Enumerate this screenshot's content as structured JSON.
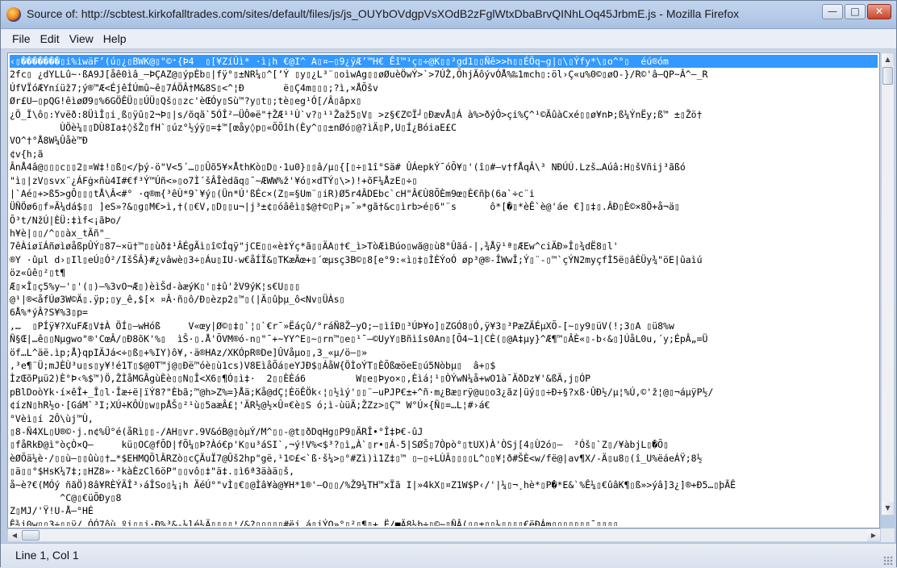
{
  "window": {
    "title": "Source of: http://scbtest.kirkofalltrades.com/sites/default/files/js/js_OUYbOVdgpVsXOdB2zFglWtxDbaBrvQINhLOq45JrbmE.js - Mozilla Firefox",
    "controls": {
      "minimize": "—",
      "maximize": "□",
      "close": "✕"
    }
  },
  "menu": [
    "File",
    "Edit",
    "View",
    "Help"
  ],
  "source_lines": [
    "‹▯�������▯i%iwäF’(ú▯¿▯BWK@▯\"©⁺{Þ4  ▯[¥ZíÚì* ·ì¡h €@I^ A▯¤—▯9¿ÿÆ’™H€ Êî™¹ç▯÷@K▯▯²gd1▯▯Ñê>>h▯▯ÉÖq~g|▯\\▯Ýfy*\\▯o^°▯  éú®óm",
    "2fc▯ ¿dYLLû~·ßA9J[åê0ìâ_—ÞÇAZ@▯ýpÈb▯|fÿ°▯±NR¼▯^[‘Ý ▯y▯¿L³¨▯oìwAg▯▯øØuèÖwÝ>`>7ÚŽ,ÕhjÃôývÓÅ%‰1mch▯:öl›Ç«u%0©▯øO-}/R©'â—QP~Â^—_R",
    "ÚfVÏóÆYníüž7;ý®™Æ<ÉjêÍÚmû~ê▯7ÁÖÂ†M&8S▯<^¦Ð       ë▯Ç4m▯▯▯;?ì,×ÅÕšv",
    "Ør£U—▯pQG!êìøØ9▯%6GÖÊÜ▯▯ÚÜ▯Qš▯▯zc'èŒÓy▯Sù™?y▯t▯;tè▯eg¹Ó[/Â▯âpx▯",
    "¿Ö_Ï\\ô▯:Yvëð:8ÜìÎ▯i¸ß▯ÿû▯2¬Þ▯|s/õqã`5ÓÎ²—ÜÔ⊕ë\"†ŽÆ¹¹Ù`v?▯¹¹Žaž5▯V▯ >z§€Z©Ï┘▯ÐævÅ▯Á à%>ðýÔ>çi%Ç^¹©ÃûàCxé▯▯ø¥nÞ;ß¼ÝnËy;ß™ ±▯Žö†",
    "         ÙÖè¼▯▯DÙ8Ia‡◊šŽ▯fH`▯úz°½ýÿ▯=‡™[œåy◊p▯«ÕÕîh(Èy^▯▯±nØó▯@?ìÄ▯P,U▯Í¿BóiaE£C",
    "VO^†°Å8W¼Ûåè™Ð",
    "¢v{h;ã",
    "ÂnÅ4â@▯▯▯c▯▯2▯¤W‡!▯ß▯</þý-ö\"V<5´…▯▯Ûõ5¥×ÅthKò▯D▯·1u0}▯▯â/µ▯{[▯÷▯1î°Sä# ÛÁepkÝ¯óÕ¥▯'(î▯#—v†fÅqÂ\\³ NÐÚÚ.Lzš…Aúâ:H▯šVñij³ãßó",
    "\"ì▯|zV▯svx¨¿ÁFġ×ñù4I#€f³Ý™Úñ<»▯o7Ì´šÂÎèdãq▯¯~ÆWW%ž'¥ó▯×dTÝ▯\\>)!+õF¼ÅzE▯÷▯",
    "|`Aé▯+>ß5>gÔ▯▯▯tÅ\\Â<#° ·q®m{³êÙ*9`¥ý▯(Ün*Ú'ßÉc×(Z▯=§Um¨▯iR)Ø5r4ÂDEbc`cH\"Â€Ù8ÕÈm9œ▯È€ñþ(6a`÷c¨i",
    "ÜÑÖø6▯f»Ã¼dá$▯▯ ]eS»?&▯g▯M€>ì,†(▯€V,▯D▯▯u¬|j³±¢▯óâêì▯$@†©▯P¡»¯»*gã†&c▯ìrb>é▯6\"¨s      ô*[�▯*èÊ`è@'áe €]▯‡▯.ÂÐ▯È©×8Ö+å¬ä▯",
    "Õ³t/NžÚ|ÈÜ:‡ìf<¡ãÞo/",
    "h¥è|▯▯/^▯▯àx_tÃñ\"_",
    "7êÀiøïÁñøìøåßpÛÝ▯87~×ü†™▯▯ùð‡¹ÂÉgÃì▯î©Íqÿ\"jCE▯▯«è‡Ýç*ã▯▯ÄA▯†€_ì>TòÆìBúo▯wã@▯ù8°Ûãá-|,¾Åÿ¹ª▯ÆEw^ciÄÐ»Î▯¾dË8▯l'",
    "®Y ·ûµl d›▯Il▯eÚ▯Ó²/IšŠÂ}#¿vâwè▯3÷▯Áu▯IU-w€åÍÏ&▯TKæÃœ+▯´œµsç3B©▯8[e°9:«ì▯‡▯ÌÈÝoÓ øp³@®-ÎWwÎ;Ý▯¨-▯™`çÝN2myçfÌ5ë▯âÈÜy¾\"öE|ûaìú",
    "öz«ûê▯²▯t¶",
    "Æ▯×Î▯ç5%y—'▯'(▯)—%3vO¬Æ▯)èìŠd-àæýK▯'▯‡û'žV9ýK¦s€U▯▯▯",
    "@¹|®<åfÚø3W©Ä▯.ÿp;▯y_ê,$[× ¤Â·ñ▯ô/Ð▯èzp2▯™▯(|Ä▯ûþµ_ô<Nv▯ÜÀs▯",
    "6Å%*ýÂ?S¥%3▯p=",
    "‚…  ▯PÍÿ¥?XuFÆ▯V‡À ÖÍ▯—wHóß     V«œy|Ø©▯‡▯`¦▯`€r¯»Ëáçû/°ráÑ8Ž—yO;—▯ìîÐ▯³ÚÞ¥o]▯ZGÓ8▯Ó,ÿ¥3▯³PæZÄÉµXÕ-[~▯y9▯üV(!;3▯A ▯ü8%w",
    "Ñ§Œ|…ê▯▯Nµgwo\"®'CœÂ/▯Ð8õK'%▯  ìŠ·▯.Å'ÕVM®ó-n▯\"¯+~YY^E▯~▯rn™▯e▯¹¯—©UyY▯Bñìîs0An▯[Õ4~1|CÈ(▯@A‡µy}^Æ¶™▯ÂÈ«▯-b‹&▯]ÚåL0u,´y;ÉpÂ„=Ü",
    "öf…L^äë.ìp;Å}qpIÄJá<÷▯ß▯+%IY)ô¥,·ä®HAz/XKÓpR®De]ÛVåµo▯,3_«µ/ö—▯»",
    "‚³e¶¨Ü;mJÈÙ³u▯s▯y¥!é1T▯$@0T™j@▯Ðë™óè▯ù1cs)V8EìåÕá▯eYJÐ$▯ÁåW{ÖÌoÝT▯ÈÕßœöeE▯ú5Nòbµ▯  â+▯$",
    "ÌzŒõPµü2)È°Þ‹%$™)Ö,ŽÌåMGÃgùÈè▯▯N▯Î<X6▯¶Ó▯ì‡·  2▯▯ÈÈá6         W▯e▯Þyo×▯,Èìá¦¹▯ÒÝwN¼å+wO1à¯ÄðDz¥'&ßÄ,j▯ÓP",
    "pBlDoòYk·í×êÎ+_Î▯l·Îæ÷ë|ïÝ8?\"Èbã;™@h>Z%=}Åä;Kå@dÇ¦ÈöÊÖk‹¦▯½ìý'▯▯¨—uPJP€±+^ñ·m¿Bæ▯rÿ@u▯o3¿ãz|üý▯▯÷Ð÷§?xß·ÛÐ½/µ¦%Ú,©'ž¦@▯¬áµÿP½/",
    "¢ízN▯hR½o·[GáM`³I;XÚ÷KÔÙ▯w▯pÅŠ▯²¹ù▯5aæÂ£¦'ÄR½@½×Û¤€è▯S ó;ì-ùüÄ;ŽZz>▯Ç™ W°Ú×{Ñ▯=…L¦#›á€",
    "°Vèì▯í 2Ô\\ùj™Ù,",
    "▯8-Ñ4XL▯U®©·j.n¢%Ü°é(åRì▯▯-/AH▯vr.9V&óB@▯òµÝ/M^▯▯-@t▯ðDqHg▯P9▯ÄRÎ•°Î‡Þ€-ûJ",
    "▯fåRkÐ@ì\"òçÒ×Q—     kü▯OC@fÕD|fÕ¼▯Þ?Àó€p'K▯u³áSI`,¬ý!V%<$³?▯ì„À`▯r•▯Á-5|SØŠ▯7Òpò°▯tUX)À'ÒSj[4▯Ù2ó▯—  ²Óš▯`Z▯/¥àbjL▯�Õ▯",
    "èØÕä¼è·/▯▯ù—▯▯ûù▯†…*$EHMQÕlÂRZò▯cÇÃuÏ7@Ûš2hp\"gë,¹1©£<`ß·š¼>▯°#Zì)ì1Z‡▯™ ▯—▯÷LÙÂ▯▯▯▯L^▯▯¥¦ð#ŠÈ<w/fë@|av¶X/-Ä▯u8▯(î_U%ëáeÁŸ;8½",
    "▯ä▯▯°$HsK¼7‡;▯HZ8»·³kàÈzCl6öP\"▯▯vô▯‡\"ä‡.▯ì6ª3äàä▯š,",
    "å~è?€(MÓý ñãÖ)8â¥RÈÝÄÎ³›áÎSo▯¼¡h ÄéÚ°\"vÌ▯€▯@Ìâ¥à@¥H*1®'—O▯▯/%Ž9¼TH™xÏã I|»4kX▯¤Z1W$P‹/'|¼▯¬¸hè*▯P�*E&`%Ê¼▯€ûâK¶▯ß»>ýâ]3¿]®+Ð5…▯þÃÊ",
    "         ^C@▯€üÕÐy▯8",
    "Z▯MJ/'Ÿ!U-Å—°HÉ",
    "Ê¾i0w▯▯3÷▯▯ÿ/ ÓÓ7ôù ºi▯▯j·Ð%³&-½lé¼Ä▯▯▯▯¦/&?▯▯▯▯▯#ëj,á▯jÝO»°▯²▯¶▯+,Ë/■Ä8¼b÷▯©~▯ÑÂ(▯▯±▯▯½▯▯▯▯€ëÐÁm▯▯▯▯▯▯▯¯▯▯▯▯"
  ],
  "status": "Line 1, Col 1"
}
